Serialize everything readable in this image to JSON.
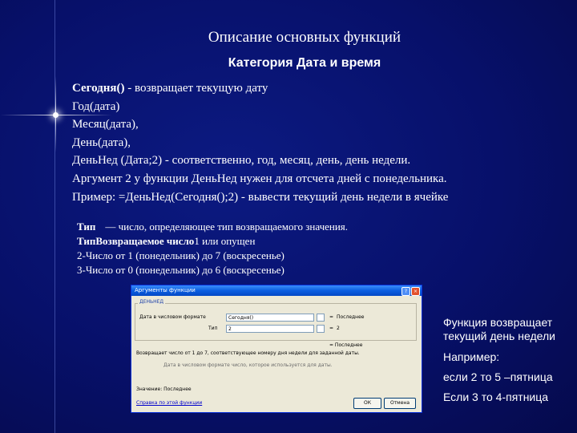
{
  "title": "Описание основных функций",
  "subtitle": "Категория Дата и время",
  "lines": [
    {
      "bold": "Сегодня()",
      "rest": " - возвращает текущую дату"
    },
    {
      "bold": "",
      "rest": "Год(дата)"
    },
    {
      "bold": "",
      "rest": " Месяц(дата),"
    },
    {
      "bold": "",
      "rest": "День(дата),"
    },
    {
      "bold": "",
      "rest": "ДеньНед (Дата;2) - соответственно, год, месяц, день, день недели."
    },
    {
      "bold": "",
      "rest": "Аргумент 2 у функции ДеньНед нужен для отсчета дней с понедельника."
    },
    {
      "bold": "",
      "rest": "Пример: =ДеньНед(Сегодня();2) - вывести текущий день недели в ячейке"
    }
  ],
  "notes": {
    "line1_bold": "Тип",
    "line1_rest": "— число, определяющее тип возвращаемого значения.",
    "line2_bold": "ТипВозвращаемое число",
    "line2_rest": "1 или опущен",
    "line3": "2-Число от 1 (понедельник) до 7 (воскресенье)",
    "line4": "3-Число от 0 (понедельник) до 6 (воскресенье)"
  },
  "dialog": {
    "title": "Аргументы функции",
    "group_label": "ДЕНЬНЕД",
    "arg1_label": "Дата в числовом формате",
    "arg1_value": "Сегодня()",
    "arg1_result": "Последнее",
    "arg2_label": "Тип",
    "arg2_value": "2",
    "arg2_result": "2",
    "eq": "=",
    "result_line": "=  Последнее",
    "description": "Возвращает число от 1 до 7, соответствующее номеру дня недели для заданной даты.",
    "hint": "Дата в числовом формате  число, которое используется для даты.",
    "value_label": "Значение:  Последнее",
    "help_link": "Справка по этой функции",
    "ok_label": "ОК",
    "cancel_label": "Отмена"
  },
  "side": {
    "line1": "Функция возвращает",
    "line2": "текущий день недели",
    "line3": "Например:",
    "line4": "если 2 то 5 –пятница",
    "line5": "Если 3 то 4-пятница"
  }
}
